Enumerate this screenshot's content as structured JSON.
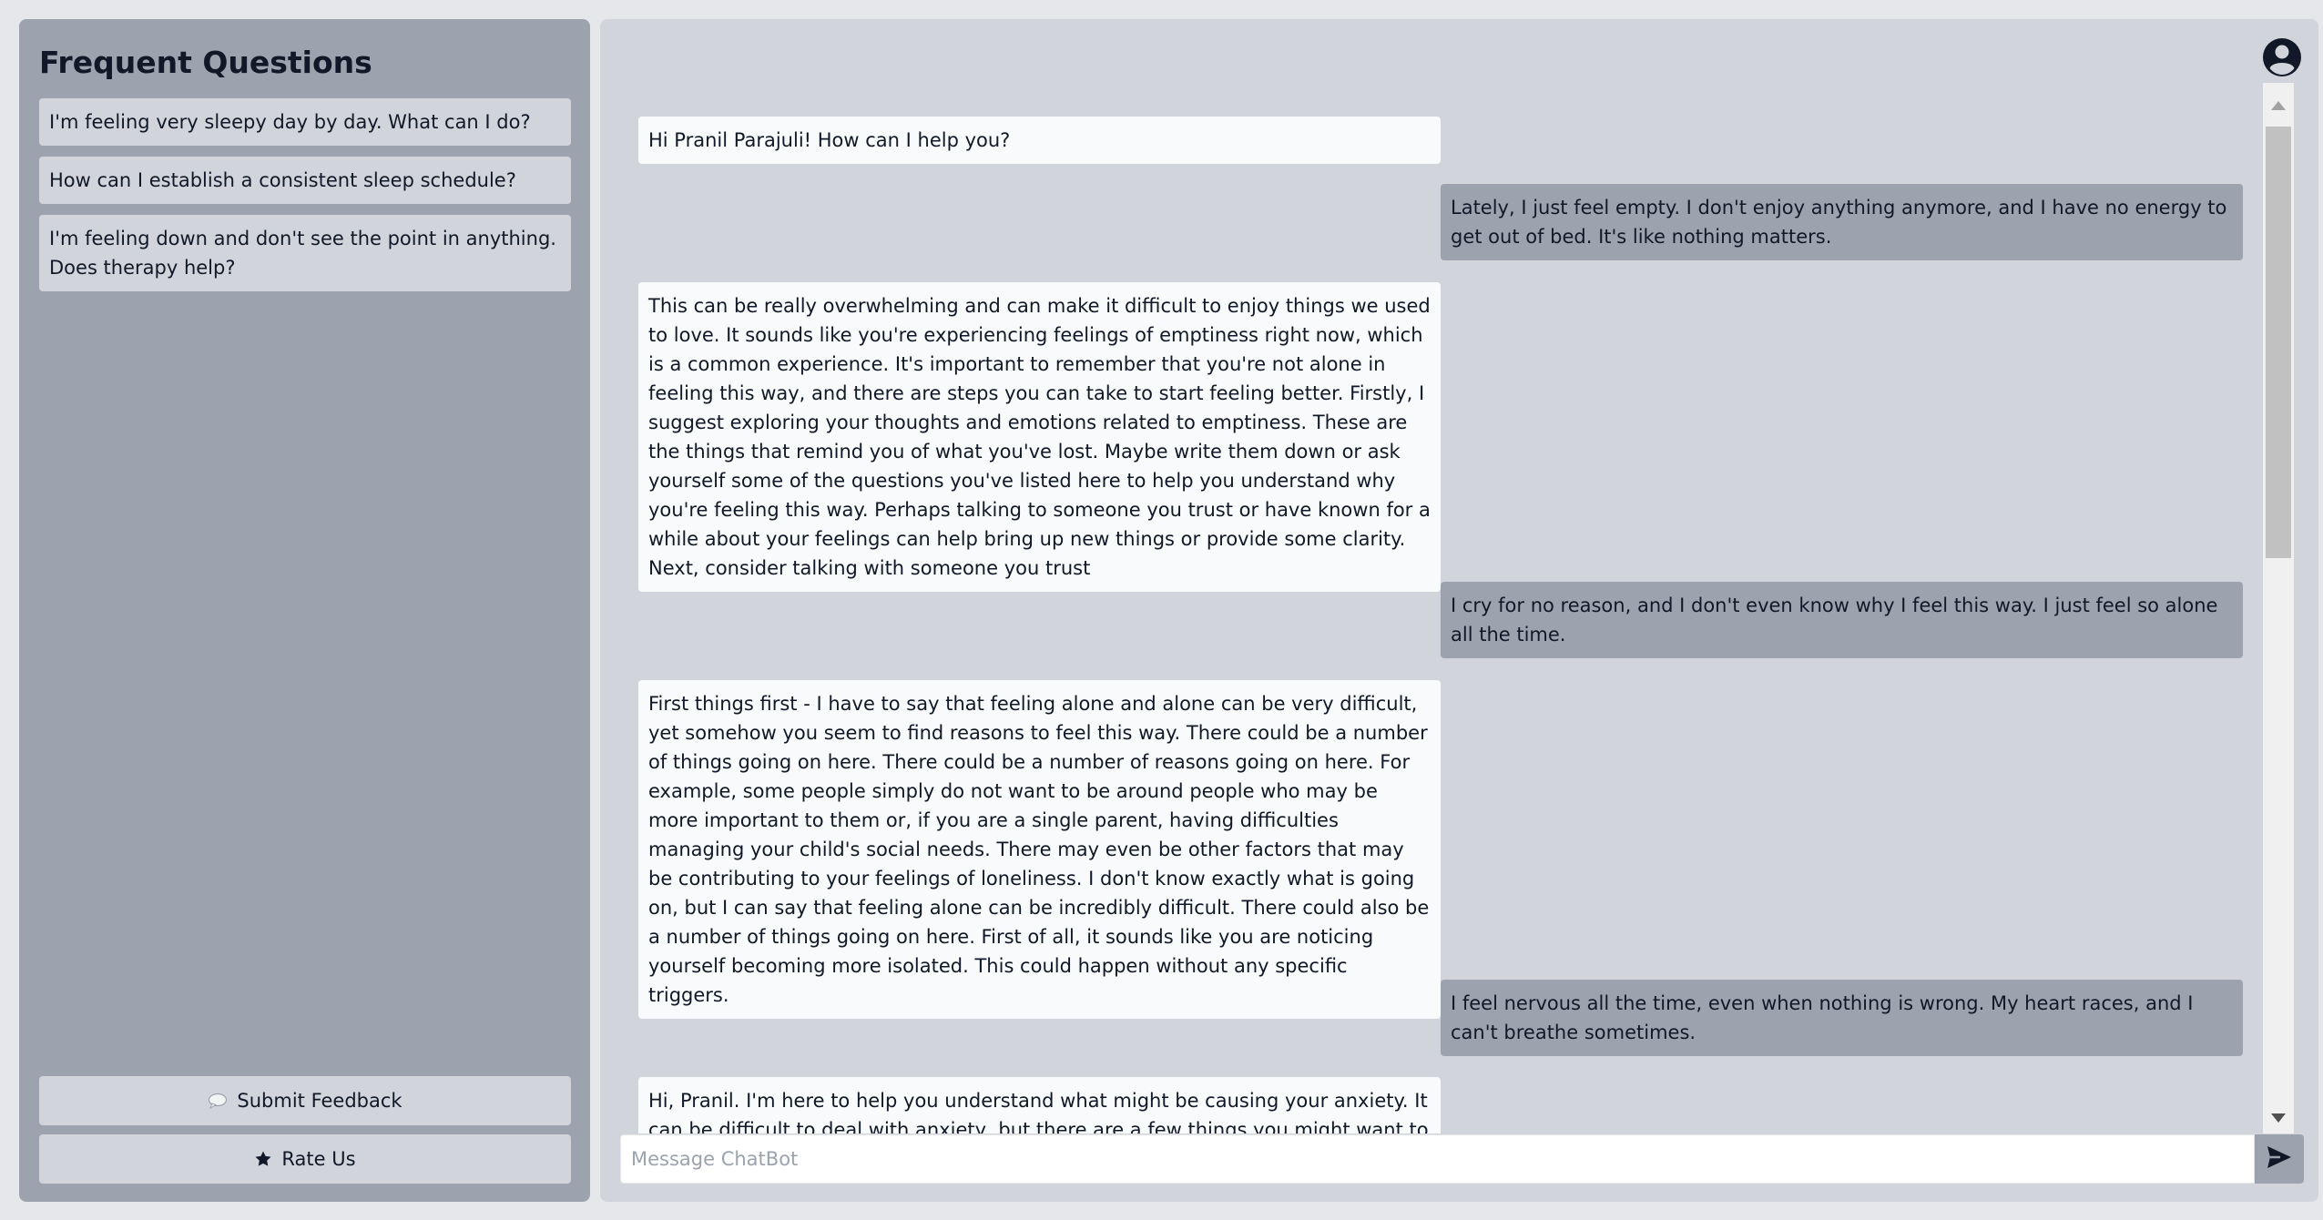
{
  "sidebar": {
    "title": "Frequent Questions",
    "questions": [
      "I'm feeling very sleepy day by day. What can I do?",
      "How can I establish a consistent sleep schedule?",
      "I'm feeling down and don't see the point in anything. Does therapy help?"
    ],
    "feedback_label": "Submit Feedback",
    "feedback_icon": "speech-bubble-icon",
    "rate_label": "Rate Us",
    "rate_icon": "star-icon"
  },
  "chat": {
    "messages": [
      {
        "role": "bot",
        "text": "Hi Pranil Parajuli! How can I help you?"
      },
      {
        "role": "user",
        "text": "Lately, I just feel empty. I don't enjoy anything anymore, and I have no energy to get out of bed. It's like nothing matters."
      },
      {
        "role": "bot",
        "text": "This can be really overwhelming and can make it difficult to enjoy things we used to love. It sounds like you're experiencing feelings of emptiness right now, which is a common experience. It's important to remember that you're not alone in feeling this way, and there are steps you can take to start feeling better. Firstly, I suggest exploring your thoughts and emotions related to emptiness. These are the things that remind you of what you've lost. Maybe write them down or ask yourself some of the questions you've listed here to help you understand why you're feeling this way. Perhaps talking to someone you trust or have known for a while about your feelings can help bring up new things or provide some clarity. Next, consider talking with someone you trust"
      },
      {
        "role": "user",
        "text": "I cry for no reason, and I don't even know why I feel this way. I just feel so alone all the time."
      },
      {
        "role": "bot",
        "text": "First things first - I have to say that feeling alone and alone can be very difficult, yet somehow you seem to find reasons to feel this way. There could be a number of things going on here. There could be a number of reasons going on here. For example, some people simply do not want to be around people who may be more important to them or, if you are a single parent, having difficulties managing your child's social needs. There may even be other factors that may be contributing to your feelings of loneliness. I don't know exactly what is going on, but I can say that feeling alone can be incredibly difficult. There could also be a number of things going on here. First of all, it sounds like you are noticing yourself becoming more isolated. This could happen without any specific triggers."
      },
      {
        "role": "user",
        "text": "I feel nervous all the time, even when nothing is wrong. My heart races, and I can't breathe sometimes."
      },
      {
        "role": "bot",
        "text": "Hi, Pranil. I'm here to help you understand what might be causing your anxiety. It can be difficult to deal with anxiety, but there are a few things you might want to try. First, try"
      }
    ],
    "input_placeholder": "Message ChatBot",
    "input_value": "",
    "send_icon": "send-icon",
    "avatar_icon": "user-avatar-icon"
  }
}
